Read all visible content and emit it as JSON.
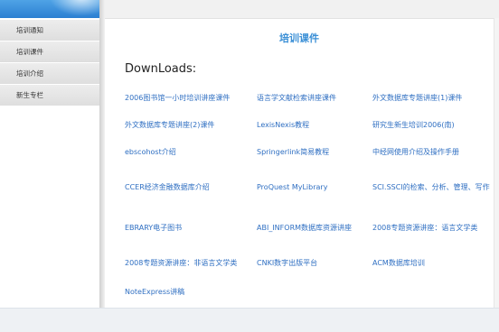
{
  "sidebar": {
    "items": [
      {
        "label": "培训通知"
      },
      {
        "label": "培训课件"
      },
      {
        "label": "培训介绍"
      },
      {
        "label": "新生专栏"
      }
    ]
  },
  "main": {
    "title": "培训课件",
    "downloads_heading": "DownLoads:",
    "links": [
      {
        "label": "2006图书馆一小时培训讲座课件"
      },
      {
        "label": "语言学文献检索讲座课件"
      },
      {
        "label": "外文数据库专题讲座(1)课件"
      },
      {
        "label": "外文数据库专题讲座(2)课件"
      },
      {
        "label": "LexisNexis教程"
      },
      {
        "label": "研究生新生培训2006(南)"
      },
      {
        "label": "ebscohost介绍"
      },
      {
        "label": "Springerlink简易教程"
      },
      {
        "label": "中经网使用介绍及操作手册"
      },
      {
        "label": "CCER经济金融数据库介绍"
      },
      {
        "label": "ProQuest MyLibrary"
      },
      {
        "label": "SCI.SSCI的检索、分析、管理、写作"
      },
      {
        "label": "EBRARY电子图书"
      },
      {
        "label": "ABI_INFORM数据库资源讲座"
      },
      {
        "label": "2008专题资源讲座：语言文学类"
      },
      {
        "label": "2008专题资源讲座：非语言文学类"
      },
      {
        "label": "CNKI数字出版平台"
      },
      {
        "label": "ACM数据库培训"
      },
      {
        "label": "NoteExpress讲稿"
      }
    ]
  },
  "colors": {
    "accent": "#3a8fd6",
    "link": "#2f6fc2",
    "banner": "#2b7fd2"
  }
}
